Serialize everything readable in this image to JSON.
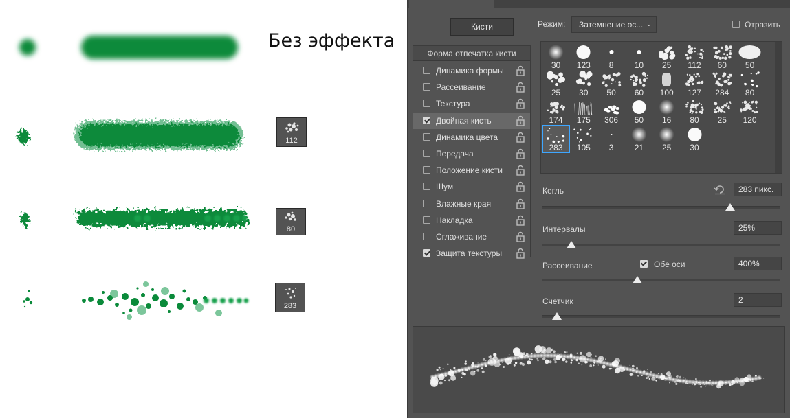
{
  "left_panel": {
    "caption": "Без эффекта",
    "thumbs": [
      {
        "number": "112"
      },
      {
        "number": "80"
      },
      {
        "number": "283"
      }
    ],
    "stroke_color": "#0a8a3a"
  },
  "brush_panel": {
    "brushes_button": "Кисти",
    "mode_label": "Режим:",
    "mode_value": "Затемнение ос...",
    "reflect_label": "Отразить",
    "list_header": "Форма отпечатка кисти",
    "items": [
      {
        "label": "Динамика формы",
        "checked": false
      },
      {
        "label": "Рассеивание",
        "checked": false
      },
      {
        "label": "Текстура",
        "checked": false
      },
      {
        "label": "Двойная кисть",
        "checked": true,
        "selected": true
      },
      {
        "label": "Динамика цвета",
        "checked": false
      },
      {
        "label": "Передача",
        "checked": false
      },
      {
        "label": "Положение кисти",
        "checked": false
      },
      {
        "label": "Шум",
        "checked": false
      },
      {
        "label": "Влажные края",
        "checked": false
      },
      {
        "label": "Накладка",
        "checked": false
      },
      {
        "label": "Сглаживание",
        "checked": false
      },
      {
        "label": "Защита текстуры",
        "checked": true
      }
    ],
    "presets": [
      "30",
      "123",
      "8",
      "10",
      "25",
      "112",
      "60",
      "50",
      "25",
      "30",
      "50",
      "60",
      "100",
      "127",
      "284",
      "80",
      "174",
      "175",
      "306",
      "50",
      "16",
      "80",
      "25",
      "120",
      "283",
      "105",
      "3",
      "21",
      "25",
      "30"
    ],
    "selected_preset": "283",
    "size_label": "Кегль",
    "size_value": "283 пикс.",
    "spacing_label": "Интервалы",
    "spacing_value": "25%",
    "scatter_label": "Рассеивание",
    "both_axes_label": "Обе оси",
    "scatter_value": "400%",
    "count_label": "Счетчик",
    "count_value": "2",
    "slider_levels": {
      "size": 0.79,
      "spacing": 0.12,
      "scatter": 0.4,
      "count": 0.06
    },
    "accent_color": "#3ea6ff"
  }
}
